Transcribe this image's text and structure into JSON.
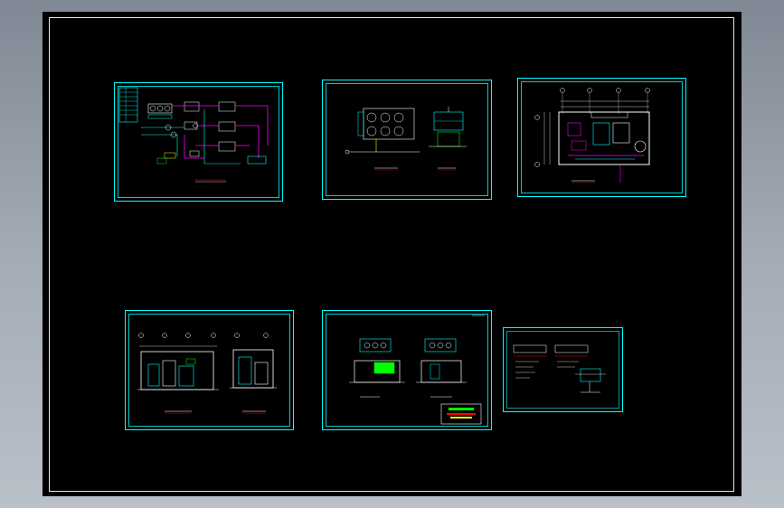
{
  "viewer": {
    "background": "#000000",
    "frame_color": "#e8e8e8"
  },
  "colors": {
    "border": "#00ffff",
    "line": "#ffffff",
    "pipe": "#ff00ff",
    "equip_green": "#00ff00",
    "equip_yellow": "#ffff00",
    "equip_red": "#ff0000",
    "dim_blue": "#3030ff"
  },
  "sheets": [
    {
      "id": "system-diagram",
      "kind": "schematic"
    },
    {
      "id": "unit-plan",
      "kind": "plan-small"
    },
    {
      "id": "room-plan",
      "kind": "room-plan"
    },
    {
      "id": "section-elevation",
      "kind": "section"
    },
    {
      "id": "unit-elevation",
      "kind": "elevation"
    },
    {
      "id": "detail",
      "kind": "detail"
    }
  ]
}
